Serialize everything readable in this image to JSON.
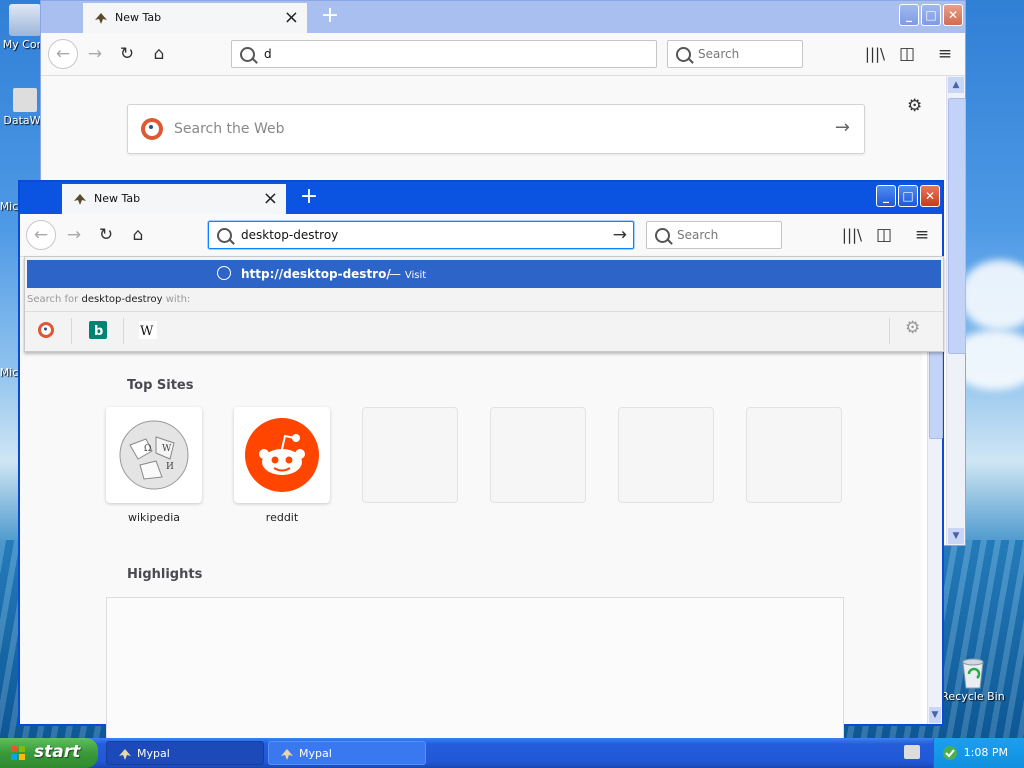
{
  "desktop": {
    "icons": [
      {
        "label": "My Com"
      },
      {
        "label": "DataWa"
      },
      {
        "label": "Mic"
      },
      {
        "label": "Mic"
      },
      {
        "label": "Recycle Bin"
      }
    ]
  },
  "back_window": {
    "tab_title": "New Tab",
    "url_text": "d",
    "search_placeholder": "Search",
    "ddg_placeholder": "Search the Web"
  },
  "front_window": {
    "tab_title": "New Tab",
    "url_text": "desktop-destroy",
    "search_placeholder": "Search",
    "dropdown": {
      "visit_url": "http://desktop-destro/",
      "visit_sep": " — ",
      "visit_label": "Visit",
      "search_prefix": "Search for ",
      "search_term": "desktop-destroy",
      "search_suffix": " with:"
    },
    "top_sites_heading": "Top Sites",
    "top_sites": [
      {
        "label": "wikipedia",
        "icon": "wikipedia-globe"
      },
      {
        "label": "reddit",
        "icon": "reddit-alien"
      },
      {
        "label": ""
      },
      {
        "label": ""
      },
      {
        "label": ""
      },
      {
        "label": ""
      }
    ],
    "highlights_heading": "Highlights"
  },
  "taskbar": {
    "start_label": "start",
    "tasks": [
      {
        "label": "Mypal"
      },
      {
        "label": "Mypal"
      }
    ],
    "clock": "1:08 PM"
  },
  "colors": {
    "taskbar": "#245edb",
    "start_green": "#3a9a3a",
    "window_titlebar": "#0b54e2",
    "dropdown_highlight": "#2d64c8"
  }
}
